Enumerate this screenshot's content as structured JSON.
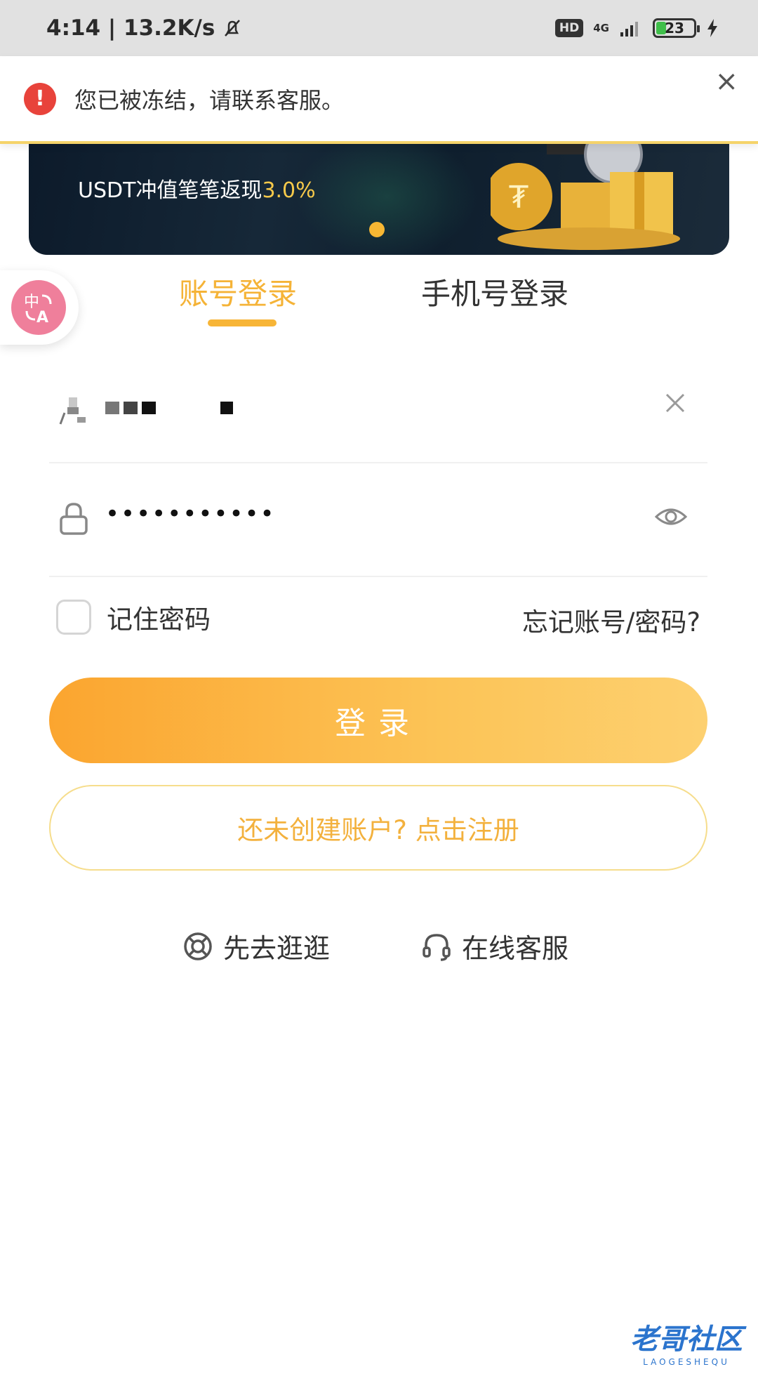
{
  "status_bar": {
    "time_speed": "4:14 | 13.2K/s",
    "hd": "HD",
    "network": "4G",
    "battery": "23"
  },
  "toast": {
    "message": "您已被冻结，请联系客服。",
    "icon": "error-icon",
    "close": "×"
  },
  "banner": {
    "headline": "",
    "subline_prefix": "USDT冲值笔笔返现",
    "subline_highlight": "3.0%",
    "page_indicator": 1
  },
  "tabs": {
    "account": "账号登录",
    "phone": "手机号登录",
    "active": "account"
  },
  "form": {
    "username_masked": true,
    "password_value": "•••••••••••",
    "remember_label": "记住密码",
    "forgot_label": "忘记账号/密码?"
  },
  "buttons": {
    "login": "登录",
    "register": "还未创建账户? 点击注册"
  },
  "bottom_links": {
    "guest": "先去逛逛",
    "support": "在线客服"
  },
  "watermark": {
    "title": "老哥社区",
    "sub": "LAOGESHEQU"
  },
  "colors": {
    "accent": "#f7b537",
    "error": "#e8433b",
    "translate_fab": "#ef7f9b"
  }
}
